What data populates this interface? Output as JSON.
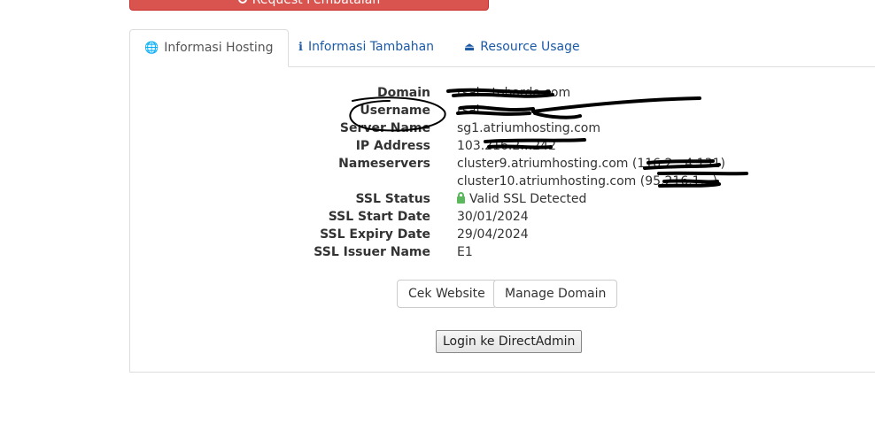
{
  "top_button": {
    "label": "Request Pembatalan"
  },
  "tabs": [
    {
      "label": "Informasi Hosting",
      "icon": "globe-icon"
    },
    {
      "label": "Informasi Tambahan",
      "icon": "info-icon"
    },
    {
      "label": "Resource Usage",
      "icon": "hdd-icon"
    }
  ],
  "info": {
    "domain": {
      "label": "Domain",
      "value": "rsal…tohardo.com"
    },
    "username": {
      "label": "Username",
      "value": "rsal…"
    },
    "server_name": {
      "label": "Server Name",
      "value": "sg1.atriumhosting.com"
    },
    "ip_address": {
      "label": "IP Address",
      "value": "103.216.2…242"
    },
    "nameservers": {
      "label": "Nameservers",
      "ns1": "cluster9.atriumhosting.com (116.2…4.131)",
      "ns2": "cluster10.atriumhosting.com (95.216.1…)"
    },
    "ssl_status": {
      "label": "SSL Status",
      "value": "Valid SSL Detected"
    },
    "ssl_start": {
      "label": "SSL Start Date",
      "value": "30/01/2024"
    },
    "ssl_expiry": {
      "label": "SSL Expiry Date",
      "value": "29/04/2024"
    },
    "ssl_issuer": {
      "label": "SSL Issuer Name",
      "value": "E1"
    }
  },
  "buttons": {
    "check_website": "Cek Website",
    "manage_domain": "Manage Domain",
    "login_directadmin": "Login ke DirectAdmin"
  },
  "colors": {
    "danger": "#d9534f",
    "link": "#1c5aa6",
    "success": "#5cb85c"
  }
}
